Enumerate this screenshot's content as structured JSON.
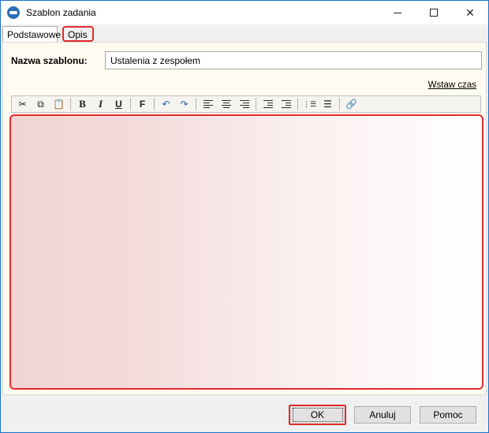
{
  "window": {
    "title": "Szablon zadania",
    "controls": {
      "minimize": "—",
      "maximize": "☐",
      "close": "✕"
    }
  },
  "tabs": [
    {
      "label": "Podstawowe"
    },
    {
      "label": "Opis"
    }
  ],
  "form": {
    "name_label": "Nazwa szablonu:",
    "name_value": "Ustalenia z zespołem",
    "insert_time_link": "Wstaw czas"
  },
  "toolbar": {
    "bold": "B",
    "italic": "I",
    "underline": "U",
    "font": "F",
    "icons": [
      "cut-icon",
      "copy-icon",
      "paste-icon",
      "bold-icon",
      "italic-icon",
      "underline-icon",
      "font-icon",
      "undo-icon",
      "redo-icon",
      "align-left-icon",
      "align-center-icon",
      "align-right-icon",
      "outdent-icon",
      "indent-icon",
      "numbered-list-icon",
      "bulleted-list-icon",
      "link-icon"
    ]
  },
  "buttons": {
    "ok": "OK",
    "cancel": "Anuluj",
    "help": "Pomoc"
  },
  "colors": {
    "highlight": "#e02b2b",
    "panel_bg": "#fffbf0"
  }
}
